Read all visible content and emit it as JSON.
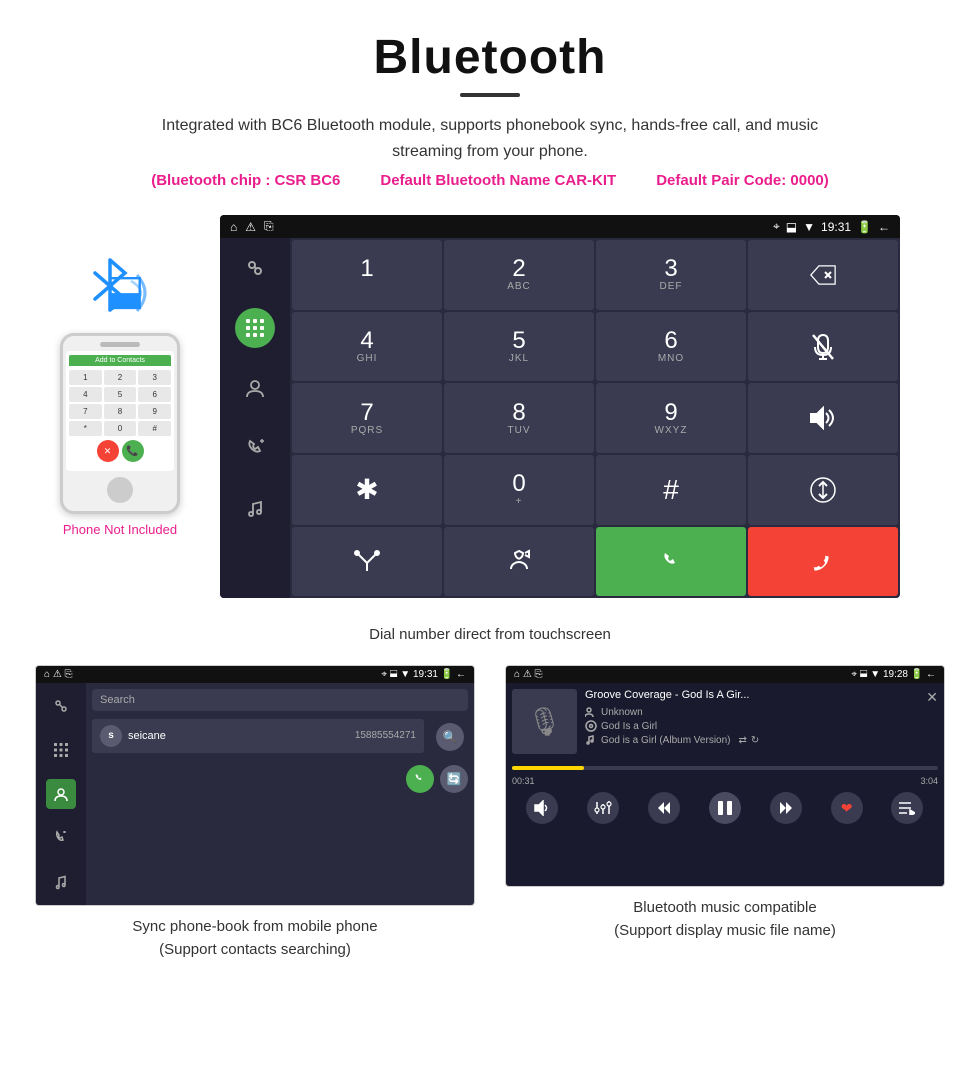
{
  "header": {
    "title": "Bluetooth",
    "subtitle": "Integrated with BC6 Bluetooth module, supports phonebook sync, hands-free call, and music streaming from your phone.",
    "chip_info": "(Bluetooth chip : CSR BC6",
    "default_name": "Default Bluetooth Name CAR-KIT",
    "default_pair": "Default Pair Code: 0000)"
  },
  "dialpad": {
    "caption": "Dial number direct from touchscreen",
    "statusbar": {
      "time": "19:31",
      "left_icons": "▲  ⚠  ⌨",
      "right_icons": "📍 🔵 📶"
    },
    "keys": [
      {
        "main": "1",
        "sub": ""
      },
      {
        "main": "2",
        "sub": "ABC"
      },
      {
        "main": "3",
        "sub": "DEF"
      },
      {
        "main": "⌫",
        "sub": ""
      },
      {
        "main": "4",
        "sub": "GHI"
      },
      {
        "main": "5",
        "sub": "JKL"
      },
      {
        "main": "6",
        "sub": "MNO"
      },
      {
        "main": "🎤",
        "sub": ""
      },
      {
        "main": "7",
        "sub": "PQRS"
      },
      {
        "main": "8",
        "sub": "TUV"
      },
      {
        "main": "9",
        "sub": "WXYZ"
      },
      {
        "main": "🔊",
        "sub": ""
      },
      {
        "main": "✱",
        "sub": ""
      },
      {
        "main": "0",
        "sub": "+"
      },
      {
        "main": "#",
        "sub": ""
      },
      {
        "main": "⇅",
        "sub": ""
      },
      {
        "main": "⬆",
        "sub": ""
      },
      {
        "main": "↕",
        "sub": ""
      },
      {
        "main": "📞",
        "sub": ""
      },
      {
        "main": "📵",
        "sub": ""
      }
    ]
  },
  "phonebook": {
    "caption": "Sync phone-book from mobile phone\n(Support contacts searching)",
    "statusbar_time": "19:31",
    "search_placeholder": "Search",
    "contact": {
      "initial": "s",
      "name": "seicane",
      "number": "15885554271"
    }
  },
  "music": {
    "caption": "Bluetooth music compatible\n(Support display music file name)",
    "statusbar_time": "19:28",
    "track_title": "Groove Coverage - God Is A Gir...",
    "meta1": "Unknown",
    "meta2": "God Is a Girl",
    "track3": "God is a Girl (Album Version)",
    "time_elapsed": "00:31",
    "time_total": "3:04",
    "progress_percent": 17
  },
  "phone_mockup": {
    "not_included": "Phone Not Included",
    "screen_header": "Add to Contacts",
    "keys": [
      "1",
      "2",
      "3",
      "4",
      "5",
      "6",
      "7",
      "8",
      "9",
      "*",
      "0",
      "#"
    ]
  }
}
